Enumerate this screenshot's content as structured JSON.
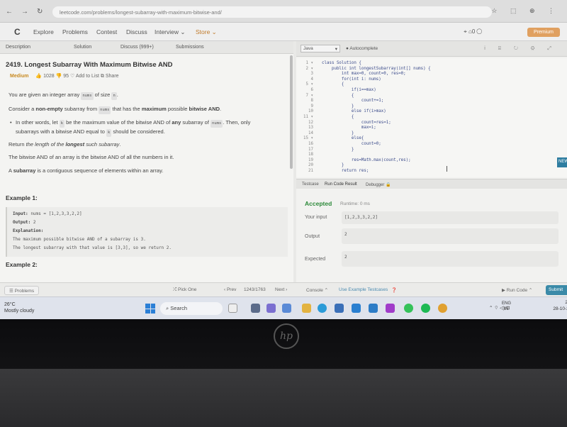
{
  "browser": {
    "url": "leetcode.com/problems/longest-subarray-with-maximum-bitwise-and/",
    "back": "←",
    "forward": "→",
    "reload": "↻",
    "icons": "☆ ⬚ ⊕ ⋮"
  },
  "lcnav": {
    "logo": "C",
    "items": [
      "Explore",
      "Problems",
      "Contest",
      "Discuss",
      "Interview ⌄",
      "Store ⌄"
    ],
    "right": "⌖  ⌂0  ◯",
    "premium": "Premium"
  },
  "left": {
    "tabs": [
      "Description",
      "Solution",
      "Discuss (999+)",
      "Submissions"
    ],
    "title": "2419. Longest Subarray With Maximum Bitwise AND",
    "difficulty": "Medium",
    "likes": "1028",
    "dislikes": "95",
    "add_to_list": "Add to List",
    "share": "Share",
    "p1_a": "You are given an integer array",
    "p1_code": "nums",
    "p1_b": "of size",
    "p1_code2": "n",
    "p1_c": ".",
    "p2_a": "Consider a",
    "p2_b": "non-empty",
    "p2_c": "subarray from",
    "p2_code": "nums",
    "p2_d": "that has the",
    "p2_e": "maximum",
    "p2_f": "possible",
    "p2_g": "bitwise AND",
    "p2_h": ".",
    "bullet_a": "In other words, let",
    "bullet_code": "k",
    "bullet_b": "be the maximum value of the bitwise AND of",
    "bullet_c": "any",
    "bullet_d": "subarray of",
    "bullet_code2": "nums",
    "bullet_e": ". Then, only subarrays with a bitwise AND equal to",
    "bullet_code3": "k",
    "bullet_f": "should be considered.",
    "p3_a": "Return",
    "p3_b": "the length of the",
    "p3_c": "longest",
    "p3_d": "such subarray",
    "p3_e": ".",
    "p4": "The bitwise AND of an array is the bitwise AND of all the numbers in it.",
    "p5_a": "A",
    "p5_b": "subarray",
    "p5_c": "is a contiguous sequence of elements within an array.",
    "example1_title": "Example 1:",
    "ex_input_label": "Input:",
    "ex_input": "nums = [1,2,3,3,2,2]",
    "ex_output_label": "Output:",
    "ex_output": "2",
    "ex_expl_label": "Explanation:",
    "ex_expl1": "The maximum possible bitwise AND of a subarray is 3.",
    "ex_expl2": "The longest subarray with that value is [3,3], so we return 2.",
    "example2_title": "Example 2:"
  },
  "editor": {
    "language": "Java",
    "autocomplete": "Autocomplete",
    "icons": "i ⌸ ↻ ⚙ ⤢",
    "line_numbers": [
      "1 ▾",
      "2 ▾",
      "3",
      "4",
      "5 ▾",
      "6",
      "7 ▾",
      "8",
      "9",
      "10",
      "11 ▾",
      "12",
      "13",
      "14",
      "15 ▾",
      "16",
      "17",
      "18",
      "19",
      "20",
      "21"
    ],
    "code": [
      "class Solution {",
      "    public int longestSubarray(int[] nums) {",
      "        int max=0, count=0, res=0;",
      "        for(int i: nums)",
      "        {",
      "            if(i==max)",
      "            {",
      "                count+=1;",
      "            }",
      "            else if(i>max)",
      "            {",
      "                count=res=1;",
      "                max=i;",
      "            }",
      "            else{",
      "                count=0;",
      "            }",
      "",
      "            res=Math.max(count,res);",
      "        }",
      "        return res;"
    ]
  },
  "bottom_tabs": [
    "Testcase",
    "Run Code Result",
    "Debugger 🔒"
  ],
  "result": {
    "status": "Accepted",
    "runtime": "Runtime: 0 ms",
    "your_input_label": "Your input",
    "your_input": "[1,2,3,3,2,2]",
    "output_label": "Output",
    "output": "2",
    "expected_label": "Expected",
    "expected": "2"
  },
  "bottombar": {
    "problems": "☰ Problems",
    "pick_one": "⤮ Pick One",
    "prev": "‹ Prev",
    "counter": "1243/1763",
    "next": "Next ›",
    "console": "Console ⌃",
    "use_example": "Use Example Testcases",
    "run_code": "▶ Run Code ⌃",
    "submit": "Submit",
    "new_badge": "NEW"
  },
  "taskbar": {
    "temp": "26°C",
    "weather": "Mostly cloudy",
    "search": "Search",
    "lang1": "ENG",
    "lang2": "IN",
    "tray": "⌃  ⌔ ◁) ⊡",
    "time": "20:4",
    "date": "28-10-202"
  },
  "laptop": {
    "logo": "hp"
  }
}
